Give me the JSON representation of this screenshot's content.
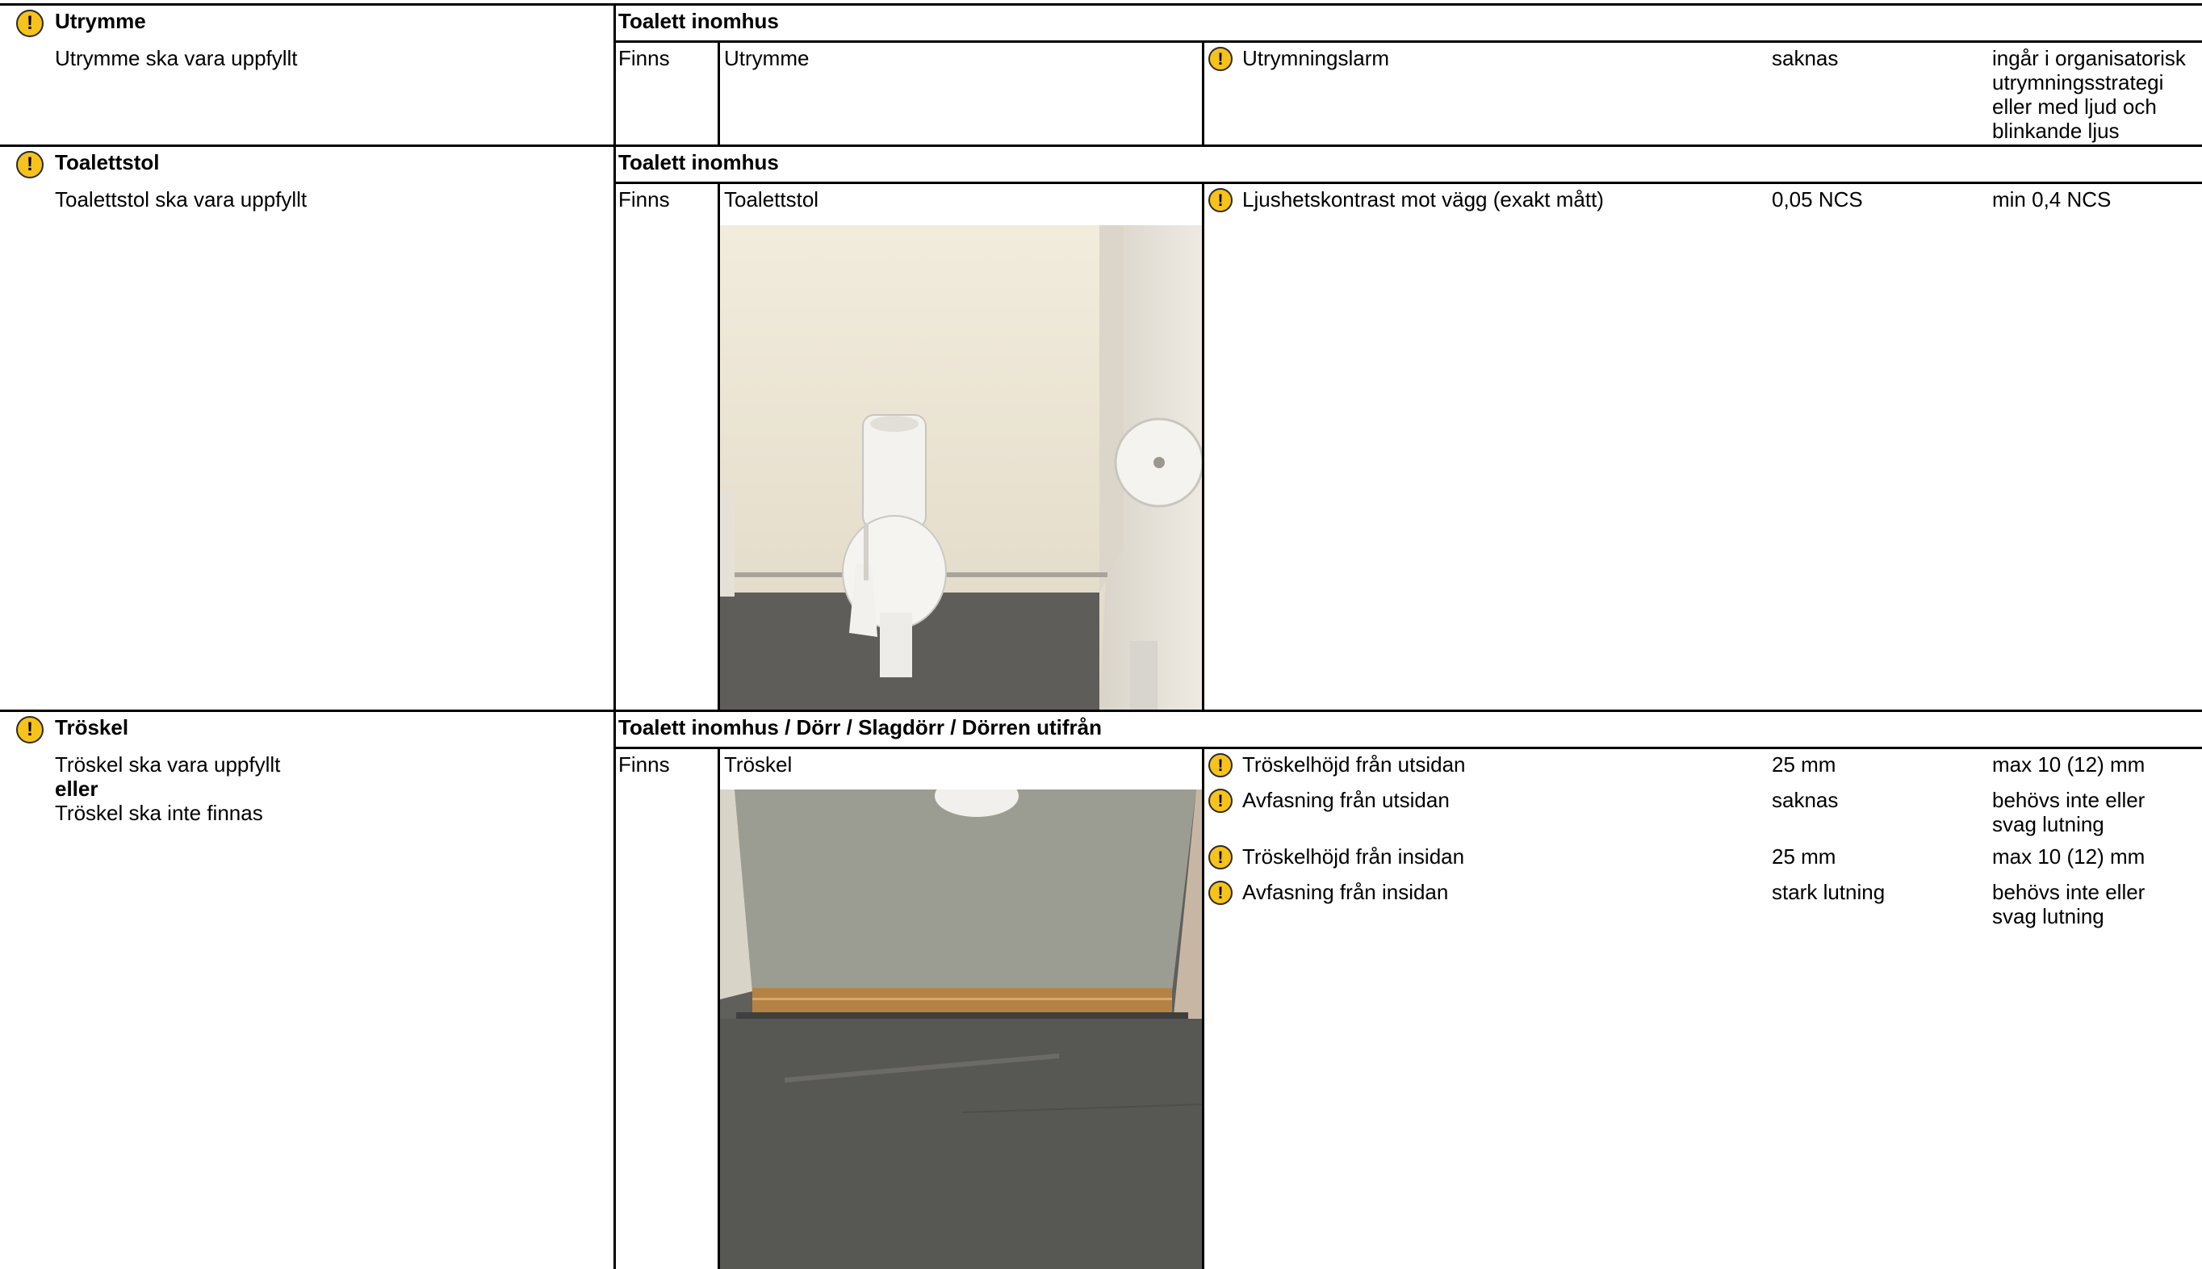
{
  "sections": [
    {
      "title": "Utrymme",
      "requirement": [
        "Utrymme ska vara uppfyllt"
      ],
      "header": "Toalett inomhus",
      "status": "Finns",
      "object": "Utrymme",
      "rows": [
        {
          "label": "Utrymningslarm",
          "value": "saknas",
          "requirement": "ingår i organisatorisk utrymningsstrategi eller med ljud och blinkande ljus"
        }
      ]
    },
    {
      "title": "Toalettstol",
      "requirement": [
        "Toalettstol ska vara uppfyllt"
      ],
      "header": "Toalett inomhus",
      "status": "Finns",
      "object": "Toalettstol",
      "rows": [
        {
          "label": "Ljushetskontrast mot vägg (exakt mått)",
          "value": "0,05 NCS",
          "requirement": "min 0,4 NCS"
        }
      ]
    },
    {
      "title": "Tröskel",
      "requirement": [
        "Tröskel ska vara uppfyllt",
        "eller",
        "Tröskel ska inte finnas"
      ],
      "header": "Toalett inomhus / Dörr / Slagdörr / Dörren utifrån",
      "status": "Finns",
      "object": "Tröskel",
      "rows": [
        {
          "label": "Tröskelhöjd från utsidan",
          "value": "25 mm",
          "requirement": "max 10 (12) mm"
        },
        {
          "label": "Avfasning från utsidan",
          "value": "saknas",
          "requirement": "behövs inte eller svag lutning"
        },
        {
          "label": "Tröskelhöjd från insidan",
          "value": "25 mm",
          "requirement": "max 10 (12) mm"
        },
        {
          "label": "Avfasning från insidan",
          "value": "stark lutning",
          "requirement": "behövs inte eller svag lutning"
        }
      ]
    }
  ],
  "icons": {
    "warning": "exclamation-warning-icon",
    "warning_color": "#f7c21a"
  }
}
